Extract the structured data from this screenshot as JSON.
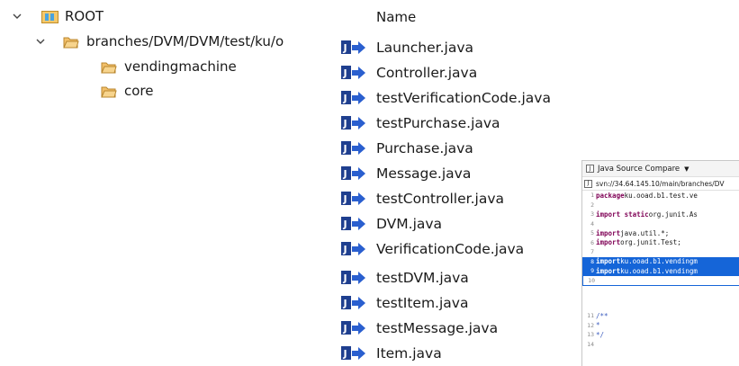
{
  "tree": {
    "root_label": "ROOT",
    "branch_label": "branches/DVM/DVM/test/ku/o",
    "children": [
      {
        "label": "vendingmachine"
      },
      {
        "label": "core"
      }
    ]
  },
  "file_list": {
    "header": "Name",
    "files": [
      "Launcher.java",
      "Controller.java",
      "testVerificationCode.java",
      "testPurchase.java",
      "Purchase.java",
      "Message.java",
      "testController.java",
      "DVM.java",
      "VerificationCode.java",
      "testDVM.java",
      "testItem.java",
      "testMessage.java",
      "Item.java"
    ]
  },
  "compare": {
    "title": "Java Source Compare",
    "path": "svn://34.64.145.10/main/branches/DV",
    "lines": [
      {
        "num": "1",
        "kw": "package",
        "text": " ku.ooad.b1.test.ve"
      },
      {
        "num": "2",
        "kw": "",
        "text": ""
      },
      {
        "num": "3",
        "kw": "import static",
        "text": " org.junit.As"
      },
      {
        "num": "4",
        "kw": "",
        "text": ""
      },
      {
        "num": "5",
        "kw": "import",
        "text": " java.util.*;"
      },
      {
        "num": "6",
        "kw": "import",
        "text": " org.junit.Test;"
      },
      {
        "num": "7",
        "kw": "",
        "text": ""
      },
      {
        "num": "8",
        "kw": "import",
        "text": " ku.ooad.b1.vendingm"
      },
      {
        "num": "9",
        "kw": "import",
        "text": " ku.ooad.b1.vendingm"
      },
      {
        "num": "10",
        "kw": "",
        "text": ""
      }
    ],
    "lower_lines": [
      {
        "num": "11",
        "text": "/**"
      },
      {
        "num": "12",
        "text": " *"
      },
      {
        "num": "13",
        "text": " */"
      },
      {
        "num": "14",
        "text": ""
      }
    ]
  },
  "colors": {
    "selection": "#1565d8",
    "folder": "#e8b04a",
    "java_icon_bg": "#1f3f8f"
  }
}
